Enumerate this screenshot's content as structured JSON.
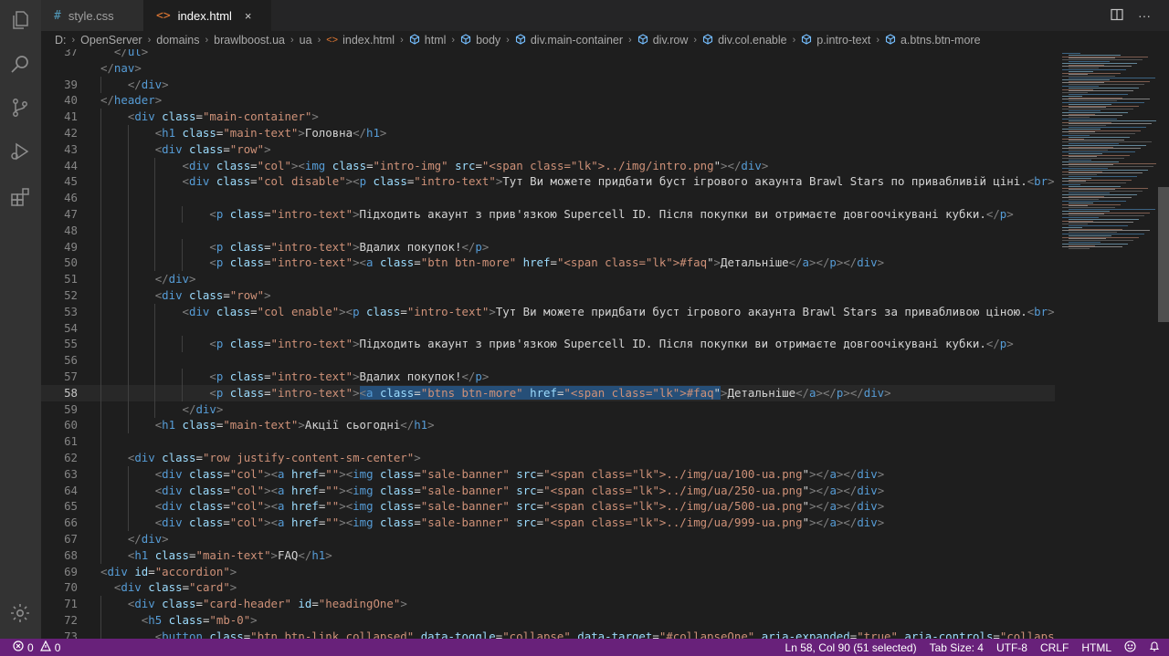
{
  "tabs": [
    {
      "icon": "#",
      "label": "style.css",
      "active": false
    },
    {
      "icon": "<>",
      "label": "index.html",
      "active": true,
      "close": "×"
    }
  ],
  "breadcrumb": [
    {
      "icon": "",
      "label": "D:"
    },
    {
      "icon": "",
      "label": "OpenServer"
    },
    {
      "icon": "",
      "label": "domains"
    },
    {
      "icon": "",
      "label": "brawlboost.ua"
    },
    {
      "icon": "",
      "label": "ua"
    },
    {
      "icon": "<>",
      "label": "index.html"
    },
    {
      "icon": "cube",
      "label": "html"
    },
    {
      "icon": "cube",
      "label": "body"
    },
    {
      "icon": "cube",
      "label": "div.main-container"
    },
    {
      "icon": "cube",
      "label": "div.row"
    },
    {
      "icon": "cube",
      "label": "div.col.enable"
    },
    {
      "icon": "cube",
      "label": "p.intro-text"
    },
    {
      "icon": "cube",
      "label": "a.btns.btn-more"
    }
  ],
  "editor": {
    "current_line": "58",
    "lines": [
      {
        "n": "37",
        "ind": 0,
        "code": "  </ul>"
      },
      {
        "n": "",
        "ind": 0,
        "code": "</nav>"
      },
      {
        "n": "39",
        "ind": 1,
        "code": "    </div>"
      },
      {
        "n": "40",
        "ind": 0,
        "code": "</header>"
      },
      {
        "n": "41",
        "ind": 1,
        "code": "    <div class=\"main-container\">"
      },
      {
        "n": "42",
        "ind": 2,
        "code": "        <h1 class=\"main-text\">Головна</h1>"
      },
      {
        "n": "43",
        "ind": 2,
        "code": "        <div class=\"row\">"
      },
      {
        "n": "44",
        "ind": 3,
        "code": "            <div class=\"col\"><img class=\"intro-img\" src=\"../img/intro.png\"></div>"
      },
      {
        "n": "45",
        "ind": 3,
        "code": "            <div class=\"col disable\"><p class=\"intro-text\">Тут Ви можете придбати буст ігрового акаунта Brawl Stars по привабливій ціні.<br> Вибе"
      },
      {
        "n": "46",
        "ind": 3,
        "code": ""
      },
      {
        "n": "47",
        "ind": 4,
        "code": "                <p class=\"intro-text\">Підходить акаунт з прив'язкою Supercell ID. Після покупки ви отримаєте довгоочікувані кубки.</p>"
      },
      {
        "n": "48",
        "ind": 3,
        "code": ""
      },
      {
        "n": "49",
        "ind": 4,
        "code": "                <p class=\"intro-text\">Вдалих покупок!</p>"
      },
      {
        "n": "50",
        "ind": 4,
        "code": "                <p class=\"intro-text\"><a class=\"btn btn-more\" href=\"#faq\">Детальніше</a></p></div>"
      },
      {
        "n": "51",
        "ind": 2,
        "code": "        </div>"
      },
      {
        "n": "52",
        "ind": 2,
        "code": "        <div class=\"row\">"
      },
      {
        "n": "53",
        "ind": 3,
        "code": "            <div class=\"col enable\"><p class=\"intro-text\">Тут Ви можете придбати буст ігрового акаунта Brawl Stars за привабливою ціною.<br> Вибе"
      },
      {
        "n": "54",
        "ind": 3,
        "code": ""
      },
      {
        "n": "55",
        "ind": 4,
        "code": "                <p class=\"intro-text\">Підходить акаунт з прив'язкою Supercell ID. Після покупки ви отримаєте довгоочікувані кубки.</p>"
      },
      {
        "n": "56",
        "ind": 3,
        "code": ""
      },
      {
        "n": "57",
        "ind": 4,
        "code": "                <p class=\"intro-text\">Вдалих покупок!</p>"
      },
      {
        "n": "58",
        "ind": 4,
        "code": "                <p class=\"intro-text\"><a class=\"btns btn-more\" href=\"#faq\">Детальніше</a></p></div>"
      },
      {
        "n": "59",
        "ind": 3,
        "code": "            </div>"
      },
      {
        "n": "60",
        "ind": 2,
        "code": "        <h1 class=\"main-text\">Акції сьогодні</h1>"
      },
      {
        "n": "61",
        "ind": 1,
        "code": ""
      },
      {
        "n": "62",
        "ind": 1,
        "code": "    <div class=\"row justify-content-sm-center\">"
      },
      {
        "n": "63",
        "ind": 2,
        "code": "        <div class=\"col\"><a href=\"\"><img class=\"sale-banner\" src=\"../img/ua/100-ua.png\"></a></div>"
      },
      {
        "n": "64",
        "ind": 2,
        "code": "        <div class=\"col\"><a href=\"\"><img class=\"sale-banner\" src=\"../img/ua/250-ua.png\"></a></div>"
      },
      {
        "n": "65",
        "ind": 2,
        "code": "        <div class=\"col\"><a href=\"\"><img class=\"sale-banner\" src=\"../img/ua/500-ua.png\"></a></div>"
      },
      {
        "n": "66",
        "ind": 2,
        "code": "        <div class=\"col\"><a href=\"\"><img class=\"sale-banner\" src=\"../img/ua/999-ua.png\"></a></div>"
      },
      {
        "n": "67",
        "ind": 1,
        "code": "    </div>"
      },
      {
        "n": "68",
        "ind": 1,
        "code": "    <h1 class=\"main-text\">FAQ</h1>"
      },
      {
        "n": "69",
        "ind": 0,
        "code": "<div id=\"accordion\">"
      },
      {
        "n": "70",
        "ind": 0,
        "code": "  <div class=\"card\">"
      },
      {
        "n": "71",
        "ind": 1,
        "code": "    <div class=\"card-header\" id=\"headingOne\">"
      },
      {
        "n": "72",
        "ind": 1,
        "code": "      <h5 class=\"mb-0\">"
      },
      {
        "n": "73",
        "ind": 1,
        "code": "        <button class=\"btn btn-link collapsed\" data-toggle=\"collapse\" data-target=\"#collapseOne\" aria-expanded=\"true\" aria-controls=\"collapseOne\""
      }
    ]
  },
  "status": {
    "errors": "0",
    "warnings": "0",
    "position": "Ln 58, Col 90 (51 selected)",
    "tab_size": "Tab Size: 4",
    "encoding": "UTF-8",
    "eol": "CRLF",
    "language": "HTML"
  },
  "colors": {
    "status_bar": "#68217a",
    "activity_bar": "#333333",
    "editor_bg": "#1e1e1e",
    "selection": "#264f78"
  }
}
